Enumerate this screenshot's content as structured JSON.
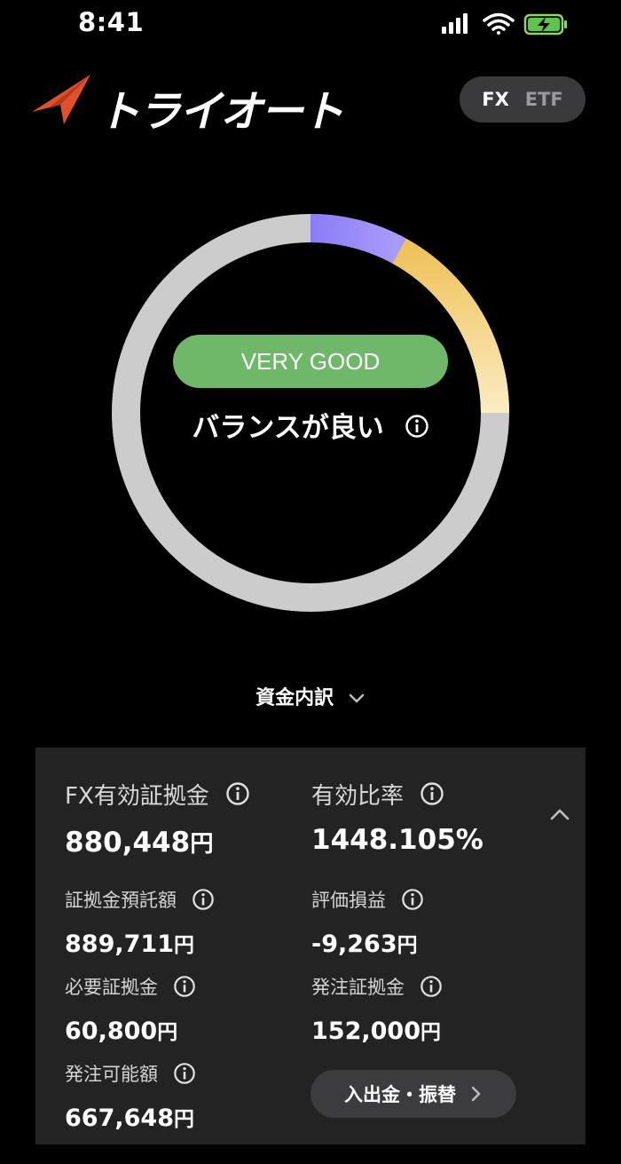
{
  "status_bar": {
    "time": "8:41"
  },
  "header": {
    "logo_text": "トライオート",
    "toggle": {
      "active": "FX",
      "inactive": "ETF"
    }
  },
  "balance": {
    "badge": "VERY GOOD",
    "message": "バランスが良い",
    "gauge_segments": [
      {
        "name": "purple",
        "fraction": 0.08,
        "color": "#7b6ef5"
      },
      {
        "name": "yellow",
        "fraction": 0.17,
        "color": "#f0c86a"
      }
    ]
  },
  "breakdown": {
    "label": "資金内訳"
  },
  "summary": {
    "fx_margin": {
      "label": "FX有効証拠金",
      "value": "880,448",
      "unit": "円"
    },
    "ratio": {
      "label": "有効比率",
      "value": "1448.105%"
    },
    "deposit": {
      "label": "証拠金預託額",
      "value": "889,711",
      "unit": "円"
    },
    "pnl": {
      "label": "評価損益",
      "value": "-9,263",
      "unit": "円"
    },
    "required": {
      "label": "必要証拠金",
      "value": "60,800",
      "unit": "円"
    },
    "order_margin": {
      "label": "発注証拠金",
      "value": "152,000",
      "unit": "円"
    },
    "available": {
      "label": "発注可能額",
      "value": "667,648",
      "unit": "円"
    },
    "transfer_button": "入出金・振替"
  },
  "colors": {
    "badge_green": "#6fb86a",
    "card_bg": "#232323",
    "ring_gray": "#cccccc"
  }
}
